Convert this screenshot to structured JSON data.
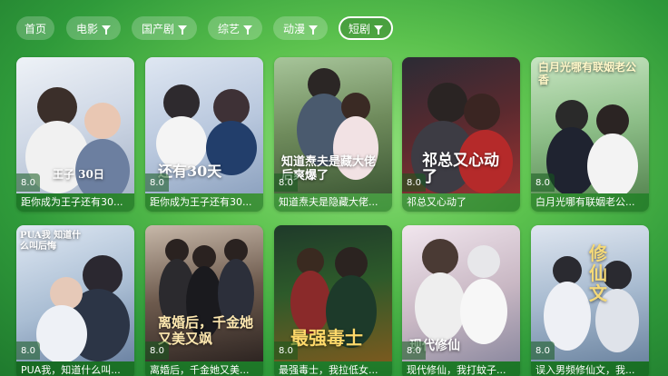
{
  "tabs": [
    {
      "label": "首页",
      "filter": false,
      "active": false
    },
    {
      "label": "电影",
      "filter": true,
      "active": false
    },
    {
      "label": "国产剧",
      "filter": true,
      "active": false
    },
    {
      "label": "综艺",
      "filter": true,
      "active": false
    },
    {
      "label": "动漫",
      "filter": true,
      "active": false
    },
    {
      "label": "短剧",
      "filter": true,
      "active": true
    }
  ],
  "items": [
    {
      "title": "距你成为王子还有30...",
      "rating": "8.0",
      "poster_art": "王子 30日",
      "poster_color": "#d9e1ec"
    },
    {
      "title": "距你成为王子还有30...",
      "rating": "8.0",
      "poster_art": "还有30天",
      "poster_color": "#c8d4e6"
    },
    {
      "title": "知道焘夫是隐藏大佬...",
      "rating": "8.0",
      "poster_art": "知道焘夫是藏大佬后爽爆了",
      "poster_color": "#6f8b5c"
    },
    {
      "title": "祁总又心动了",
      "rating": "8.0",
      "poster_art": "祁总又心动了",
      "poster_color": "#7b2d2d"
    },
    {
      "title": "白月光哪有联姻老公...",
      "rating": "8.0",
      "poster_art": "白月光哪有联姻老公香",
      "poster_color": "#7fb07a"
    },
    {
      "title": "PUA我，知道什么叫...",
      "rating": "8.0",
      "poster_art": "PUA我 知道什么叫后悔",
      "poster_color": "#9fb3c9"
    },
    {
      "title": "离婚后，千金她又美...",
      "rating": "8.0",
      "poster_art": "离婚后，千金她又美又飒",
      "poster_color": "#4a3a34"
    },
    {
      "title": "最强毒士，我拉低女...",
      "rating": "8.0",
      "poster_art": "最强毒士",
      "poster_color": "#2d5a2a"
    },
    {
      "title": "现代修仙，我打蚊子...",
      "rating": "8.0",
      "poster_art": "现代修仙",
      "poster_color": "#c9b8c4"
    },
    {
      "title": "误入男频修仙文，我...",
      "rating": "8.0",
      "poster_art": "修仙文",
      "poster_color": "#8aa7c2"
    }
  ]
}
